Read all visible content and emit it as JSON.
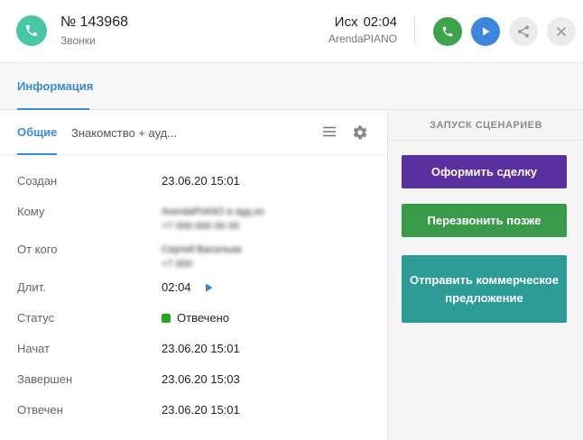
{
  "header": {
    "title": "№ 143968",
    "subtitle": "Звонки",
    "direction": "Исх",
    "time": "02:04",
    "line": "ArendaPIANO"
  },
  "tabs": {
    "info": "Информация"
  },
  "subtabs": {
    "general": "Общие",
    "intro": "Знакомство + ауд..."
  },
  "fields": {
    "created_label": "Создан",
    "created_value": "23.06.20 15:01",
    "to_label": "Кому",
    "to_value_line1": "ArendaPIANO в ауд.из",
    "to_value_line2": "+7 000 000 00 00",
    "from_label": "От кого",
    "from_value_line1": "Сергей Васильев",
    "from_value_line2": "+7 000",
    "duration_label": "Длит.",
    "duration_value": "02:04",
    "status_label": "Статус",
    "status_value": "Отвечено",
    "started_label": "Начат",
    "started_value": "23.06.20 15:01",
    "finished_label": "Завершен",
    "finished_value": "23.06.20 15:03",
    "answered_label": "Отвечен",
    "answered_value": "23.06.20 15:01"
  },
  "scenarios": {
    "heading": "ЗАПУСК СЦЕНАРИЕВ",
    "deal_button": "Оформить сделку",
    "callback_button": "Перезвонить позже",
    "offer_button": "Отправить коммерческое предложение"
  },
  "colors": {
    "avatar": "#47c7a6",
    "call_button": "#3fa34d",
    "play_button": "#3d86e0",
    "accent": "#3a8ad6",
    "deal": "#5a2fa0",
    "callback": "#3a9a4c",
    "offer": "#2d9c96",
    "status_answered": "#2aa52a"
  },
  "icons": {
    "avatar": "phone-icon",
    "call": "phone-icon",
    "play": "play-icon",
    "share": "share-icon",
    "close": "close-icon",
    "menu": "menu-icon",
    "settings": "gear-icon"
  }
}
